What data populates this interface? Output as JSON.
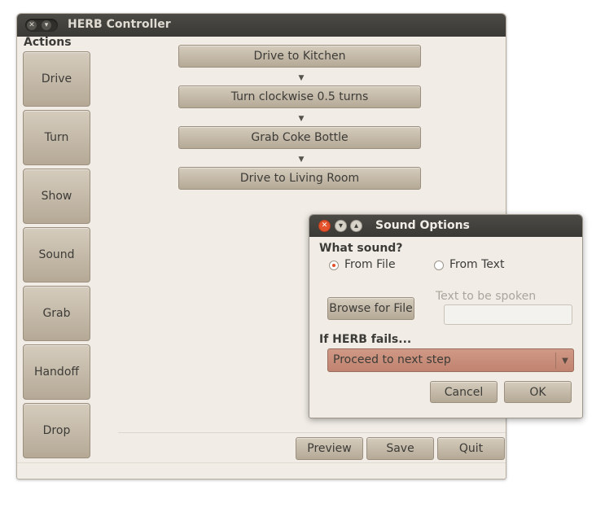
{
  "main_window": {
    "title": "HERB Controller",
    "actions_label": "Actions",
    "actions": [
      "Drive",
      "Turn",
      "Show",
      "Sound",
      "Grab",
      "Handoff",
      "Drop"
    ],
    "steps": [
      "Drive to Kitchen",
      "Turn clockwise 0.5 turns",
      "Grab Coke Bottle",
      "Drive to Living Room"
    ],
    "preview_label": "Preview",
    "save_label": "Save",
    "quit_label": "Quit"
  },
  "dialog": {
    "title": "Sound Options",
    "what_sound_label": "What sound?",
    "from_file_label": "From File",
    "from_text_label": "From Text",
    "selected_source": "From File",
    "browse_label": "Browse for File",
    "text_spoken_label": "Text to be spoken",
    "text_value": "",
    "fail_label": "If HERB fails...",
    "fail_selected": "Proceed to next step",
    "cancel_label": "Cancel",
    "ok_label": "OK"
  },
  "icons": {
    "close": "close-icon",
    "minimize": "minimize-icon",
    "maximize": "maximize-icon",
    "step_arrow": "arrow-down-icon",
    "dropdown": "dropdown-arrow-icon"
  },
  "colors": {
    "titlebar": "#3d3c38",
    "window_bg": "#f1ede6",
    "button_top": "#d5ccbd",
    "button_bottom": "#b5a996",
    "close_accent": "#e5532d",
    "dropdown_fill": "#c78c76"
  }
}
